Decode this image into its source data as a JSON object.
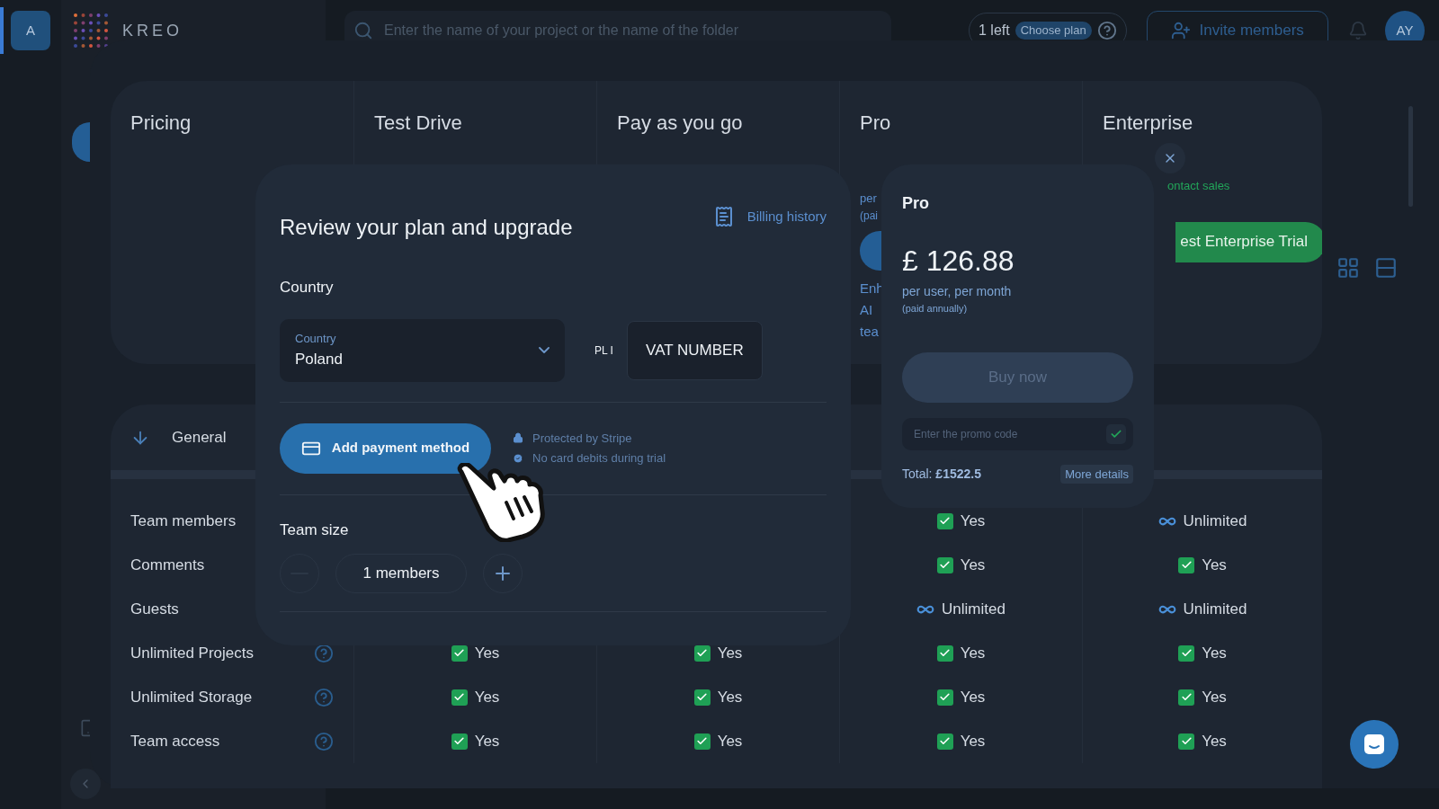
{
  "sidebar": {
    "avatar": "A"
  },
  "topbar": {
    "logo": "KREO",
    "search": {
      "placeholder": "Enter the name of your project or the name of the folder"
    },
    "plan": {
      "count": "1 left",
      "button": "Choose plan"
    },
    "invite": "Invite members",
    "avatar": "AY"
  },
  "pricing": {
    "title": "Pricing",
    "plans": [
      {
        "name": "Test Drive"
      },
      {
        "name": "Pay as you go"
      },
      {
        "name": "Pro",
        "details": [
          "per",
          "(pai",
          "Enh",
          "AI",
          "tea"
        ]
      },
      {
        "name": "Enterprise",
        "link": "ontact sales",
        "button": "est Enterprise Trial"
      }
    ]
  },
  "features": {
    "section": "General",
    "rows": [
      {
        "label": "Team members",
        "values": [
          {
            "kind": "yes",
            "text": "Yes"
          },
          {
            "kind": "unlimited",
            "text": "Unlimited"
          }
        ]
      },
      {
        "label": "Comments",
        "values": [
          {
            "kind": "yes",
            "text": "Yes"
          },
          {
            "kind": "yes",
            "text": "Yes"
          }
        ]
      },
      {
        "label": "Guests",
        "values": [
          {
            "kind": "unlimited",
            "text": "Unlimited"
          },
          {
            "kind": "unlimited",
            "text": "Unlimited"
          }
        ]
      },
      {
        "label": "Unlimited Projects",
        "help": true,
        "values": [
          {
            "kind": "yes",
            "text": "Yes"
          },
          {
            "kind": "yes",
            "text": "Yes"
          },
          {
            "kind": "yes",
            "text": "Yes"
          },
          {
            "kind": "yes",
            "text": "Yes"
          }
        ]
      },
      {
        "label": "Unlimited Storage",
        "help": true,
        "values": [
          {
            "kind": "yes",
            "text": "Yes"
          },
          {
            "kind": "yes",
            "text": "Yes"
          },
          {
            "kind": "yes",
            "text": "Yes"
          },
          {
            "kind": "yes",
            "text": "Yes"
          }
        ]
      },
      {
        "label": "Team access",
        "help": true,
        "values": [
          {
            "kind": "yes",
            "text": "Yes"
          },
          {
            "kind": "yes",
            "text": "Yes"
          },
          {
            "kind": "yes",
            "text": "Yes"
          },
          {
            "kind": "yes",
            "text": "Yes"
          }
        ]
      }
    ]
  },
  "modal": {
    "title": "Review your plan and upgrade",
    "billing_link": "Billing history",
    "country_heading": "Country",
    "country_select": {
      "label": "Country",
      "value": "Poland"
    },
    "vat_prefix": "PL I",
    "vat_field": {
      "value": "VAT NUMBER"
    },
    "payment_button": "Add payment method",
    "notes": [
      {
        "kind": "lock",
        "text": "Protected by Stripe"
      },
      {
        "kind": "check",
        "text": "No card debits during trial"
      }
    ],
    "team_heading": "Team size",
    "team_size": {
      "value": "1 members",
      "minus_disabled": true
    }
  },
  "plan_card": {
    "name": "Pro",
    "price": "£ 126.88",
    "period": "per user, per month",
    "billing": "(paid annually)",
    "buy_button": {
      "label": "Buy now",
      "disabled": true
    },
    "promo": {
      "placeholder": "Enter the promo code"
    },
    "total": "Total: **£1522.5**",
    "details_button": "More details"
  }
}
